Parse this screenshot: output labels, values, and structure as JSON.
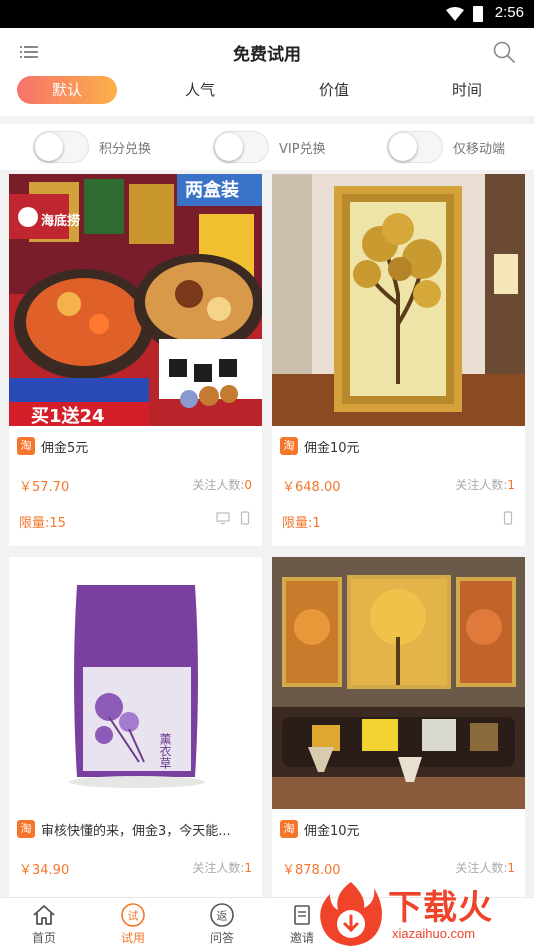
{
  "status_bar": {
    "time": "2:56"
  },
  "header": {
    "title": "免费试用"
  },
  "tabs": [
    {
      "label": "默认",
      "active": true
    },
    {
      "label": "人气"
    },
    {
      "label": "价值"
    },
    {
      "label": "时间"
    }
  ],
  "filters": [
    {
      "label": "积分兑换",
      "on": false
    },
    {
      "label": "VIP兑换",
      "on": false
    },
    {
      "label": "仅移动端",
      "on": false
    }
  ],
  "products": [
    {
      "image_text": {
        "brand": "海底捞",
        "badge": "两盒装",
        "promo": "买1送24"
      },
      "platform_badge": "淘",
      "commission": "佣金5元",
      "price": "￥57.70",
      "follow_label": "关注人数:",
      "follow_count": "0",
      "limit": "限量:15",
      "devices": [
        "pc-icon",
        "mobile-icon"
      ]
    },
    {
      "platform_badge": "淘",
      "commission": "佣金10元",
      "price": "￥648.00",
      "follow_label": "关注人数:",
      "follow_count": "1",
      "limit": "限量:1",
      "devices": [
        "mobile-icon"
      ]
    },
    {
      "image_text": {
        "product": "薰衣草"
      },
      "platform_badge": "淘",
      "commission": "审核快懂的来，佣金3，今天能...",
      "price": "￥34.90",
      "follow_label": "关注人数:",
      "follow_count": "1"
    },
    {
      "platform_badge": "淘",
      "commission": "佣金10元",
      "price": "￥878.00",
      "follow_label": "关注人数:",
      "follow_count": "1"
    }
  ],
  "bottom_nav": [
    {
      "label": "首页",
      "icon": "home-icon"
    },
    {
      "label": "试用",
      "icon": "trial-icon",
      "active": true,
      "glyph": "试"
    },
    {
      "label": "问答",
      "icon": "qa-icon",
      "glyph": "返"
    },
    {
      "label": "邀请",
      "icon": "invite-icon"
    }
  ],
  "watermark": {
    "text": "下载火",
    "sub": "xiazaihuo.com"
  },
  "colors": {
    "accent": "#f5762b",
    "tab_gradient_start": "#f8726a",
    "tab_gradient_end": "#fbb04a",
    "watermark": "#f0442a"
  }
}
